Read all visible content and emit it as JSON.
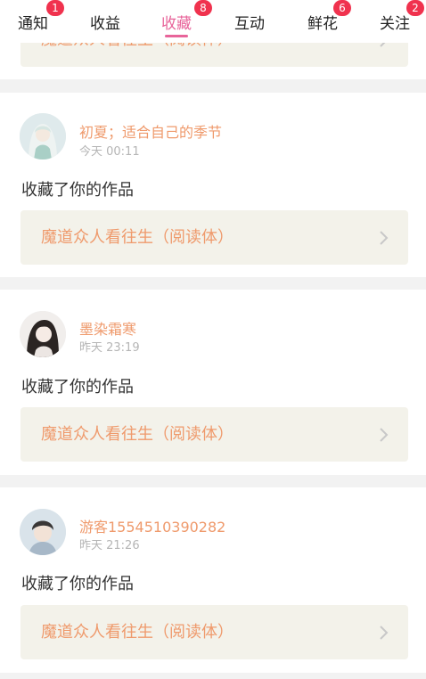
{
  "tabs": [
    {
      "label": "通知",
      "badge": "1",
      "active": false
    },
    {
      "label": "收益",
      "badge": "",
      "active": false
    },
    {
      "label": "收藏",
      "badge": "8",
      "active": true
    },
    {
      "label": "互动",
      "badge": "",
      "active": false
    },
    {
      "label": "鲜花",
      "badge": "6",
      "active": false
    },
    {
      "label": "关注",
      "badge": "2",
      "active": false
    }
  ],
  "colors": {
    "accent": "#e8649a",
    "badge": "#f0324e",
    "username": "#ef9a6c",
    "link_bg": "#f3f2ea"
  },
  "feed": {
    "partial_item": {
      "work_title": "魔道众人看往生（阅读体）"
    },
    "items": [
      {
        "username": "初夏；适合自己的季节",
        "time": "今天 00:11",
        "action": "收藏了你的作品",
        "work_title": "魔道众人看往生（阅读体）"
      },
      {
        "username": "墨染霜寒",
        "time": "昨天 23:19",
        "action": "收藏了你的作品",
        "work_title": "魔道众人看往生（阅读体）"
      },
      {
        "username": "游客1554510390282",
        "time": "昨天 21:26",
        "action": "收藏了你的作品",
        "work_title": "魔道众人看往生（阅读体）"
      }
    ]
  }
}
